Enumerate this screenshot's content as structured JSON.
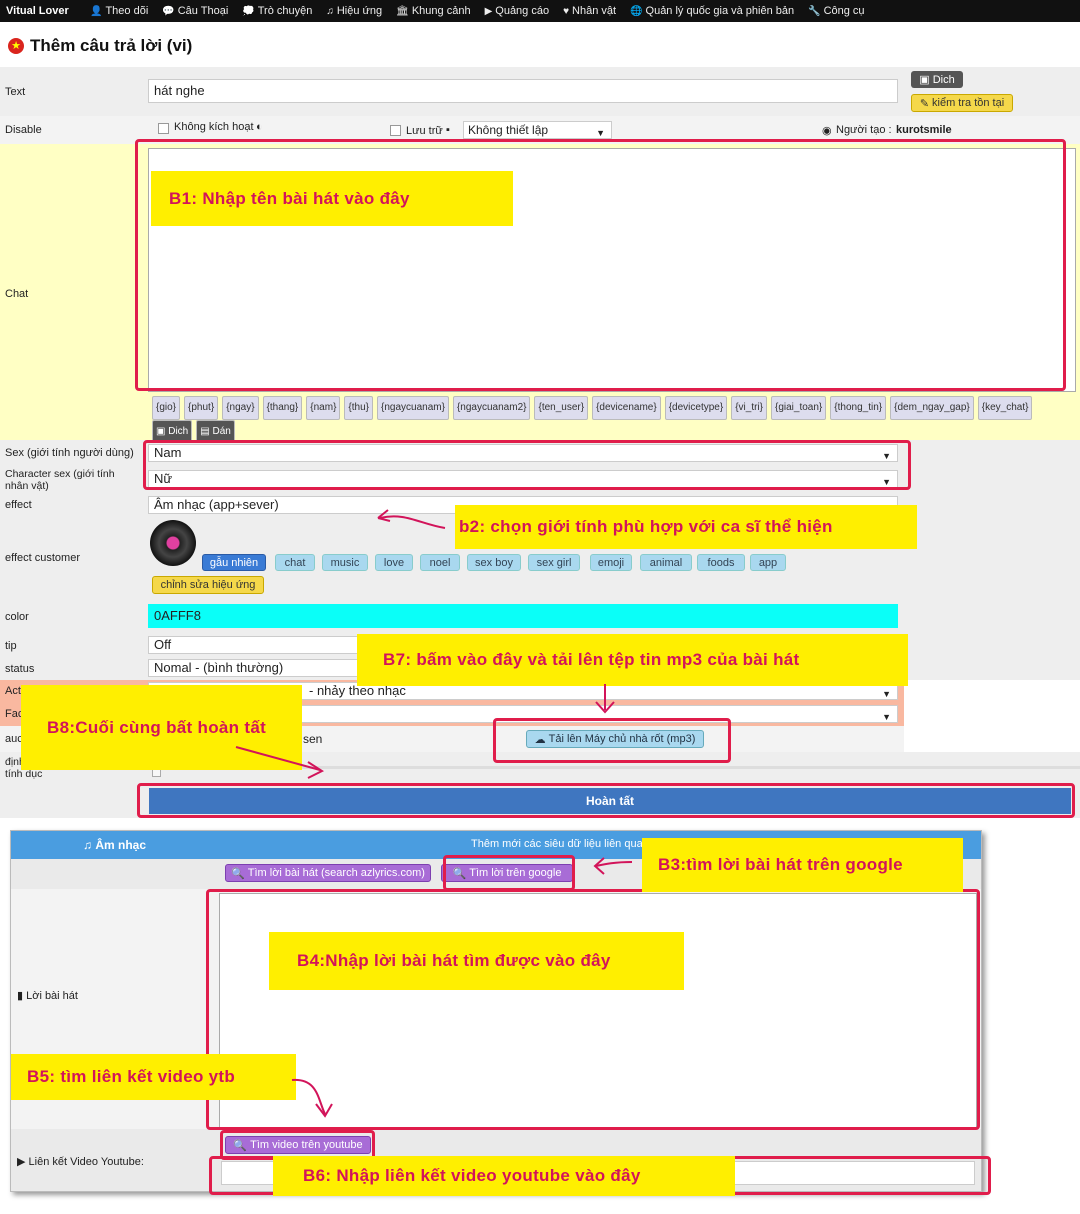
{
  "nav": {
    "brand": "Vitual Lover",
    "items": [
      {
        "icon": "user-icon",
        "glyph": "👤",
        "label": "Theo dõi"
      },
      {
        "icon": "chat-icon",
        "glyph": "💬",
        "label": "Câu Thoại"
      },
      {
        "icon": "comments-icon",
        "glyph": "💭",
        "label": "Trò chuyện"
      },
      {
        "icon": "music-icon",
        "glyph": "♫",
        "label": "Hiệu ứng"
      },
      {
        "icon": "bank-icon",
        "glyph": "🏛",
        "label": "Khung cảnh"
      },
      {
        "icon": "play-icon",
        "glyph": "▶",
        "label": "Quảng cáo"
      },
      {
        "icon": "heart-icon",
        "glyph": "♥",
        "label": "Nhân vật"
      },
      {
        "icon": "globe-icon",
        "glyph": "🌐",
        "label": "Quản lý quốc gia và phiên bản"
      },
      {
        "icon": "wrench-icon",
        "glyph": "🔧",
        "label": "Công cụ"
      }
    ]
  },
  "header": {
    "title": "Thêm câu trả lời (vi)"
  },
  "form": {
    "text_label": "Text",
    "text_value": "hát nghe",
    "translate_btn": "Dich",
    "check_exist_btn": "kiểm tra tồn tại",
    "disable_label": "Disable",
    "not_activated": "Không kích hoạt",
    "save_label": "Lưu trữ",
    "setting_select": "Không thiết lập",
    "creator_label": "Người tạo :",
    "creator_name": "kurotsmile",
    "chat_label": "Chat",
    "tags": [
      "{gio}",
      "{phut}",
      "{ngay}",
      "{thang}",
      "{nam}",
      "{thu}",
      "{ngaycuanam}",
      "{ngaycuanam2}",
      "{ten_user}",
      "{devicename}",
      "{devicetype}",
      "{vi_tri}",
      "{giai_toan}",
      "{thong_tin}",
      "{dem_ngay_gap}",
      "{key_chat}"
    ],
    "dich_btn": "Dich",
    "dan_btn": "Dán",
    "sex_label": "Sex (giới tính người dùng)",
    "sex_value": "Nam",
    "char_sex_label": "Character sex (giới tính nhân vật)",
    "char_sex_value": "Nữ",
    "effect_label": "effect",
    "effect_value": "Âm nhạc (app+sever)",
    "effect_customer_label": "effect customer",
    "effect_pills": [
      "gẫu nhiên",
      "chat",
      "music",
      "love",
      "noel",
      "sex boy",
      "sex girl",
      "emoji",
      "animal",
      "foods",
      "app"
    ],
    "edit_effect_btn": "chỉnh sửa hiệu ứng",
    "color_label": "color",
    "color_value": "0AFFF8",
    "color_hex": "#0AFFF8",
    "tip_label": "tip",
    "tip_value": "Off",
    "status_label": "status",
    "status_value": "Nomal - (bình thường)",
    "action_label": "Act",
    "action_value": "- nhảy theo nhạc",
    "face_label": "Fac",
    "audio_label": "auc",
    "audio_value": "sen",
    "upload_btn": "Tải lên Máy chủ nhà rốt (mp3)",
    "format_label": "định dạng mức độ thô tục và tính dục",
    "finish_btn": "Hoàn tất"
  },
  "music": {
    "title": "Âm nhạc",
    "header_text": "Thêm mới các siêu dữ liệu liên quan",
    "search_lyrics_btn": "Tìm lời bài hát (search azlyrics.com)",
    "search_google_btn": "Tìm lời trên google",
    "lyrics_label": "Lời bài hát",
    "youtube_btn": "Tìm video trên youtube",
    "youtube_label": "Liên kết Video Youtube:"
  },
  "notes": {
    "b1": "B1:  Nhập tên bài hát vào đây",
    "b2": "b2: chọn giới tính phù hợp với ca sĩ thể hiện",
    "b7": "B7: bấm vào đây và tải lên tệp tin mp3 của bài hát",
    "b8": "B8:Cuối cùng bất hoàn tất",
    "b3": "B3:tìm lời bài hát trên google",
    "b4": "B4:Nhập lời bài hát tìm được vào đây",
    "b5": "B5: tìm liên kết video ytb",
    "b6": "B6:  Nhập liên kết video youtube vào đây"
  }
}
